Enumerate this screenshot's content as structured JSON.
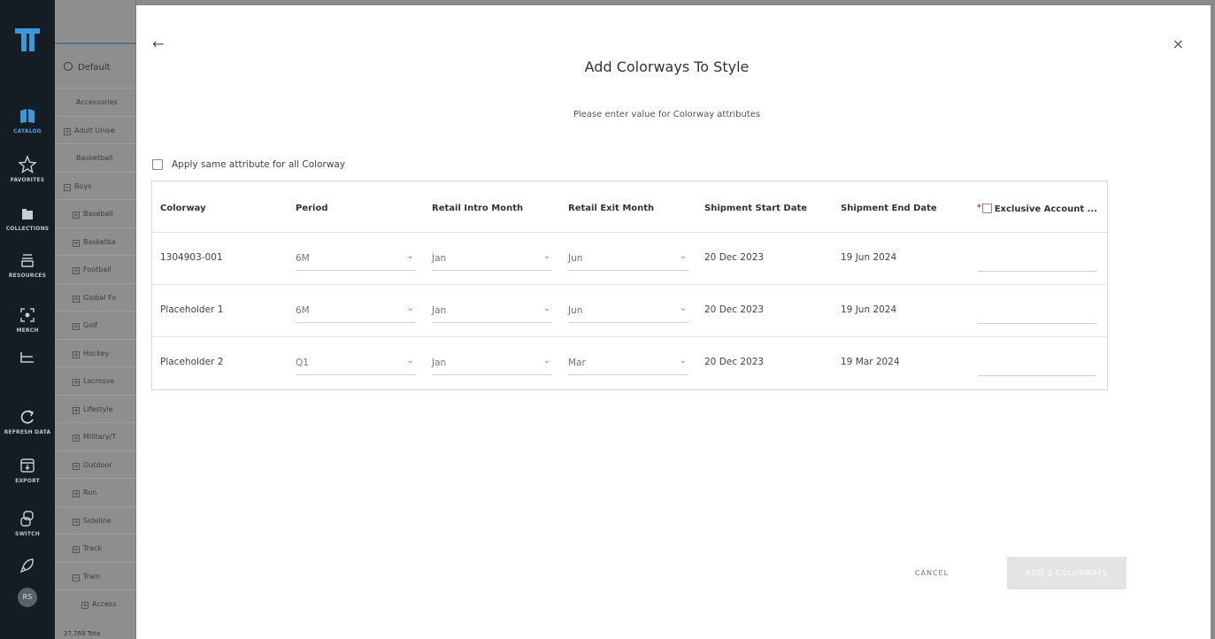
{
  "rail": {
    "items": [
      {
        "label": "CATALOG",
        "icon": "book-icon",
        "active": true
      },
      {
        "label": "FAVORITES",
        "icon": "star-icon"
      },
      {
        "label": "COLLECTIONS",
        "icon": "folder-icon"
      },
      {
        "label": "RESOURCES",
        "icon": "stack-icon"
      },
      {
        "label": "MERCH",
        "icon": "scan-icon"
      },
      {
        "label": "",
        "icon": "basket-icon"
      },
      {
        "label": "REFRESH DATA",
        "icon": "refresh-icon"
      },
      {
        "label": "EXPORT",
        "icon": "export-icon"
      },
      {
        "label": "SWITCH",
        "icon": "switch-icon"
      },
      {
        "label": "",
        "icon": "rocket-icon"
      }
    ],
    "avatar": "RS",
    "accent": "#4aa0e0"
  },
  "tree": {
    "search_text": "Default",
    "rows": [
      {
        "label": "Accessories",
        "expander": ""
      },
      {
        "label": "Adult Unise",
        "expander": "+"
      },
      {
        "label": "Basketball",
        "expander": ""
      },
      {
        "label": "Boys",
        "expander": "−"
      },
      {
        "label": "Baseball",
        "expander": "+"
      },
      {
        "label": "Basketba",
        "expander": "+"
      },
      {
        "label": "Football",
        "expander": "+"
      },
      {
        "label": "Global Fo",
        "expander": "+"
      },
      {
        "label": "Golf",
        "expander": "+"
      },
      {
        "label": "Hockey",
        "expander": "+"
      },
      {
        "label": "Lacrosse",
        "expander": "+"
      },
      {
        "label": "Lifestyle",
        "expander": "+"
      },
      {
        "label": "Military/T",
        "expander": "+"
      },
      {
        "label": "Outdoor",
        "expander": "+"
      },
      {
        "label": "Run",
        "expander": "+"
      },
      {
        "label": "Sideline",
        "expander": "+"
      },
      {
        "label": "Track",
        "expander": "+"
      },
      {
        "label": "Train",
        "expander": "−"
      },
      {
        "label": "Access",
        "expander": "+"
      }
    ],
    "footer": "27,769 Tota"
  },
  "modal": {
    "title": "Add Colorways To Style",
    "subtitle": "Please enter value for Colorway attributes",
    "apply_all_label": "Apply same attribute for all Colorway",
    "columns": {
      "colorway": "Colorway",
      "period": "Period",
      "retail_intro": "Retail Intro Month",
      "retail_exit": "Retail Exit Month",
      "ship_start": "Shipment Start Date",
      "ship_end": "Shipment End Date",
      "exclusive": "Exclusive Account ..."
    },
    "rows": [
      {
        "colorway": "1304903-001",
        "period": "6M",
        "intro": "Jan",
        "exit": "Jun",
        "ship_start": "20 Dec 2023",
        "ship_end": "19 Jun 2024"
      },
      {
        "colorway": "Placeholder 1",
        "period": "6M",
        "intro": "Jan",
        "exit": "Jun",
        "ship_start": "20 Dec 2023",
        "ship_end": "19 Jun 2024"
      },
      {
        "colorway": "Placeholder 2",
        "period": "Q1",
        "intro": "Jan",
        "exit": "Mar",
        "ship_start": "20 Dec 2023",
        "ship_end": "19 Mar 2024"
      }
    ],
    "cancel_label": "CANCEL",
    "add_label": "ADD 3 COLORWAYS",
    "back_icon": "←",
    "close_icon": "×",
    "required_mark": "*",
    "chevron": "⌄"
  }
}
